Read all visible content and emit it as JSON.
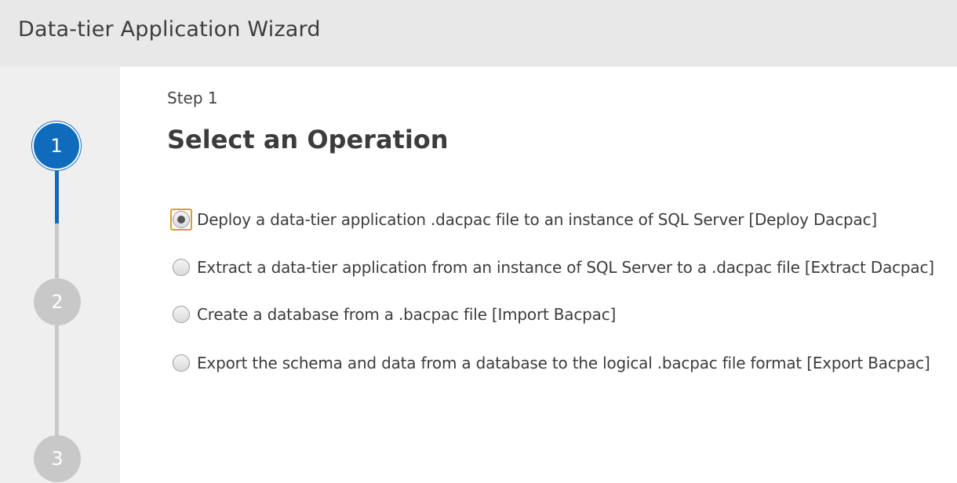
{
  "window": {
    "title": "Data-tier Application Wizard"
  },
  "stepper": {
    "steps": [
      {
        "number": "1",
        "state": "active"
      },
      {
        "number": "2",
        "state": "inactive"
      },
      {
        "number": "3",
        "state": "inactive"
      }
    ],
    "accent_color": "#0f6cbd",
    "inactive_color": "#c8c8c8"
  },
  "main": {
    "step_label": "Step 1",
    "title": "Select an Operation",
    "options": [
      {
        "label": "Deploy a data-tier application .dacpac file to an instance of SQL Server [Deploy Dacpac]",
        "selected": true
      },
      {
        "label": "Extract a data-tier application from an instance of SQL Server to a .dacpac file [Extract Dacpac]",
        "selected": false
      },
      {
        "label": "Create a database from a .bacpac file [Import Bacpac]",
        "selected": false
      },
      {
        "label": "Export the schema and data from a database to the logical .bacpac file format [Export Bacpac]",
        "selected": false
      }
    ]
  }
}
